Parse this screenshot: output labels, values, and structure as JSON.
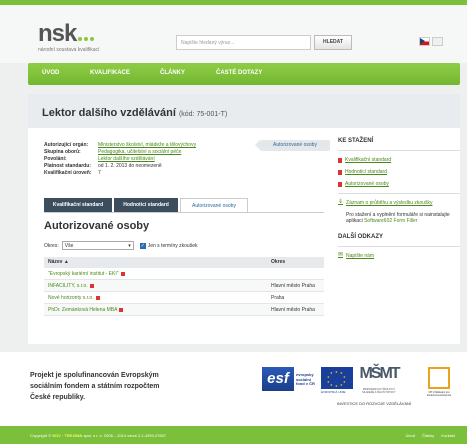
{
  "header": {
    "logo_text": "nsk",
    "logo_subtitle": "národní soustava kvalifikací",
    "search_placeholder": "Napište hledaný výraz...",
    "search_button": "HLEDAT"
  },
  "nav": {
    "items": [
      {
        "label": "ÚVOD"
      },
      {
        "label": "KVALIFIKACE"
      },
      {
        "label": "ČLÁNKY"
      },
      {
        "label": "ČASTÉ DOTAZY"
      }
    ]
  },
  "page": {
    "title": "Lektor dalšího vzdělávání",
    "code": "(kód: 75-001-T)",
    "info": [
      {
        "label": "Autorizující orgán:",
        "value": "Ministerstvo školství, mládeže a tělovýchovy",
        "link": true
      },
      {
        "label": "Skupina oborů:",
        "value": "Pedagogika, učitelství a sociální péče",
        "link": true
      },
      {
        "label": "Povolání:",
        "value": "Lektor dalšího vzdělávání",
        "link": true
      },
      {
        "label": "Platnost standardu:",
        "value": "od 1. 2. 2013 do neomezeně",
        "link": false
      },
      {
        "label": "Kvalifikační úroveň:",
        "value": "7",
        "link": false
      }
    ],
    "auth_button": "Autorizované osoby",
    "tabs": [
      {
        "label": "Kvalifikační standard"
      },
      {
        "label": "Hodnoticí standard"
      },
      {
        "label": "Autorizované osoby"
      }
    ],
    "section_title": "Autorizované osoby",
    "filter": {
      "label": "Okres:",
      "selected": "Vše",
      "checkbox_label": "Jen s termíny zkoušek"
    },
    "table": {
      "headers": [
        "Název ▲",
        "Okres"
      ],
      "rows": [
        {
          "name": "\"Evropský kariérní institut - EKI\"",
          "district": ""
        },
        {
          "name": "INFACILITY, s.r.o.",
          "district": "Hlavní město Praha"
        },
        {
          "name": "Nové horizonty s.r.o.",
          "district": "Praha"
        },
        {
          "name": "PhDr. Zemánková Helena MBA",
          "district": "Hlavní město Praha"
        }
      ]
    }
  },
  "sidebar": {
    "downloads_title": "KE STAŽENÍ",
    "downloads": [
      {
        "label": "Kvalifikační standard"
      },
      {
        "label": "Hodnoticí standard"
      },
      {
        "label": "Autorizované osoby"
      }
    ],
    "record_link": "Záznam o průběhu a výsledku zkoušky",
    "record_note_prefix": "Pro stažení a vyplnění formuláře si nainstalujte aplikaci",
    "record_note_link": "Software602 Form Filler",
    "other_title": "DALŠÍ ODKAZY",
    "other_link": "Napište nám"
  },
  "footer": {
    "project_text": "Projekt je spolufinancován Evropským sociálním fondem a státním rozpočtem České republiky.",
    "esf_logo": "esf",
    "esf_text": "evropský sociální fond v ČR",
    "eu_text": "EVROPSKÁ UNIE",
    "msmt_logo": "MŠMT",
    "msmt_text": "MINISTERSTVO ŠKOLSTVÍ, MLÁDEŽE A TĚLOVÝCHOVY",
    "opvk_text": "OP Vzdělávání pro konkurenceschopnost",
    "invest_text": "INVESTICE DO ROZVOJE VZDĚLÁVÁNÍ",
    "copyright_prefix": "Copyright ©",
    "copyright_brand": "NÚV · TREXIMA",
    "copyright_suffix": "spol. s r. o. 2006 – 2014   verze 2.1.4399.27657",
    "links": [
      "Úvod",
      "Články",
      "Kontakt"
    ]
  },
  "colors": {
    "brand_green": "#7cbf3a",
    "link_green": "#4a8a1a",
    "tab_dark": "#3c4e5e"
  }
}
